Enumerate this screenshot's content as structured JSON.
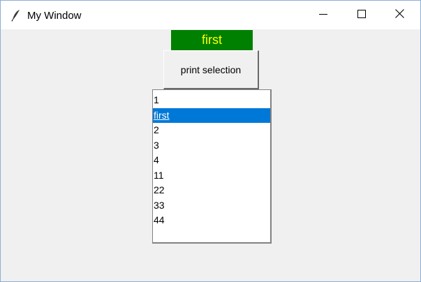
{
  "window": {
    "title": "My Window",
    "icon": "feather-icon",
    "controls": {
      "minimize": "minimize-icon",
      "maximize": "maximize-icon",
      "close": "close-icon"
    }
  },
  "label": {
    "text": "first",
    "background": "#008000",
    "color": "#ffff00"
  },
  "button": {
    "label": "print selection"
  },
  "listbox": {
    "items": [
      "1",
      "first",
      "2",
      "3",
      "4",
      "11",
      "22",
      "33",
      "44"
    ],
    "selected_index": 1,
    "selected_color": "#0078d7"
  }
}
